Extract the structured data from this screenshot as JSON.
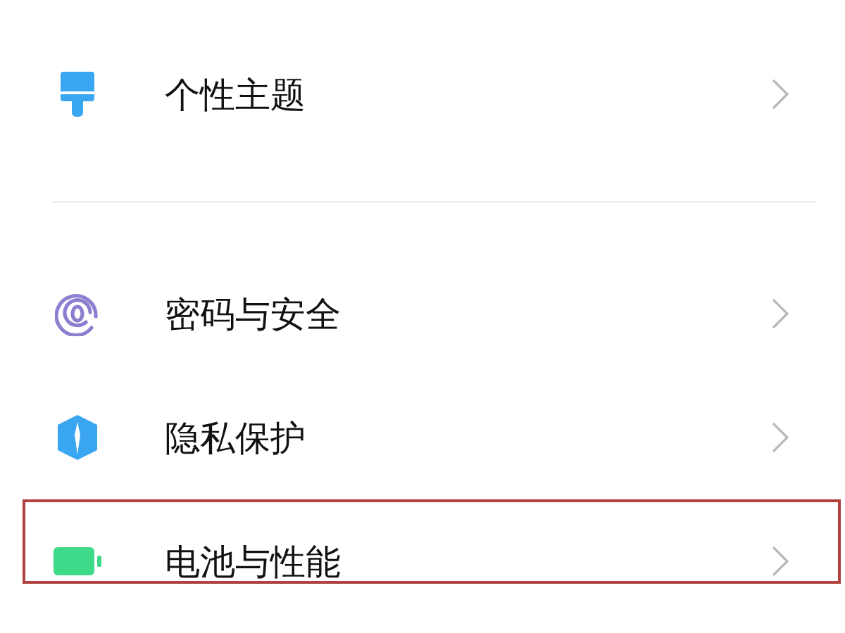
{
  "groups": [
    {
      "items": [
        {
          "kind": "brush",
          "label": "个性主题",
          "highlighted": false
        }
      ]
    },
    {
      "items": [
        {
          "kind": "fingerprint",
          "label": "密码与安全",
          "highlighted": false
        },
        {
          "kind": "shield",
          "label": "隐私保护",
          "highlighted": false
        },
        {
          "kind": "battery",
          "label": "电池与性能",
          "highlighted": true
        }
      ]
    }
  ]
}
